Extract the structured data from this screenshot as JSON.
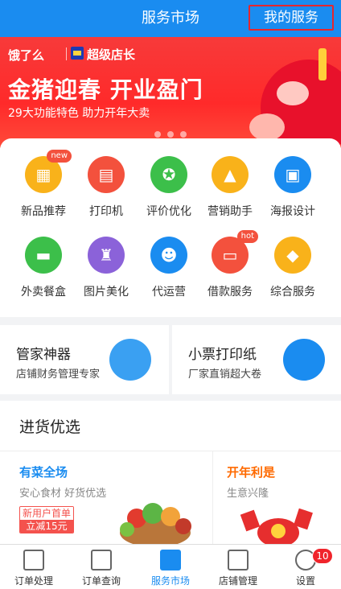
{
  "header": {
    "title": "服务市场",
    "my_service": "我的服务"
  },
  "banner": {
    "brand": "饿了么",
    "badge": "超级店长",
    "headline": "金猪迎春 开业盈门",
    "sub": "29大功能特色 助力开年大卖"
  },
  "grid": [
    {
      "label": "新品推荐",
      "icon": "gift-icon",
      "color": "#f9b21a",
      "glyph": "▦",
      "tag": "new"
    },
    {
      "label": "打印机",
      "icon": "printer-icon",
      "color": "#f3513d",
      "glyph": "▤",
      "tag": ""
    },
    {
      "label": "评价优化",
      "icon": "medal-icon",
      "color": "#3cbf4a",
      "glyph": "✪",
      "tag": ""
    },
    {
      "label": "营销助手",
      "icon": "chart-icon",
      "color": "#f9b21a",
      "glyph": "▲",
      "tag": ""
    },
    {
      "label": "海报设计",
      "icon": "image-icon",
      "color": "#1a8cf0",
      "glyph": "▣",
      "tag": ""
    },
    {
      "label": "外卖餐盒",
      "icon": "lunchbox-icon",
      "color": "#3cbf4a",
      "glyph": "▬",
      "tag": ""
    },
    {
      "label": "图片美化",
      "icon": "brush-icon",
      "color": "#8b62d9",
      "glyph": "♜",
      "tag": ""
    },
    {
      "label": "代运营",
      "icon": "robot-icon",
      "color": "#1a8cf0",
      "glyph": "☻",
      "tag": ""
    },
    {
      "label": "借款服务",
      "icon": "card-icon",
      "color": "#f3513d",
      "glyph": "▭",
      "tag": "hot"
    },
    {
      "label": "综合服务",
      "icon": "apps-icon",
      "color": "#f9b21a",
      "glyph": "◆",
      "tag": ""
    }
  ],
  "promos": [
    {
      "title": "管家神器",
      "sub": "店铺财务管理专家",
      "icon": "ledger-icon",
      "color": "#3aa0f2"
    },
    {
      "title": "小票打印纸",
      "sub": "厂家直销超大卷",
      "icon": "paper-roll-icon",
      "color": "#1a8cf0"
    }
  ],
  "purchase": {
    "title": "进货优选",
    "left": {
      "title": "有菜全场",
      "sub": "安心食材 好货优选",
      "badge1": "新用户首单",
      "badge2": "立减15元",
      "color": "#1a8cf0"
    },
    "right": {
      "title": "开年利是",
      "sub": "生意兴隆",
      "color": "#ff6a00"
    }
  },
  "tabbar": [
    {
      "label": "订单处理",
      "icon": "order-process-icon",
      "active": false,
      "badge": ""
    },
    {
      "label": "订单查询",
      "icon": "order-query-icon",
      "active": false,
      "badge": ""
    },
    {
      "label": "服务市场",
      "icon": "service-market-icon",
      "active": true,
      "badge": ""
    },
    {
      "label": "店铺管理",
      "icon": "shop-manage-icon",
      "active": false,
      "badge": ""
    },
    {
      "label": "设置",
      "icon": "settings-icon",
      "active": false,
      "badge": "10"
    }
  ]
}
